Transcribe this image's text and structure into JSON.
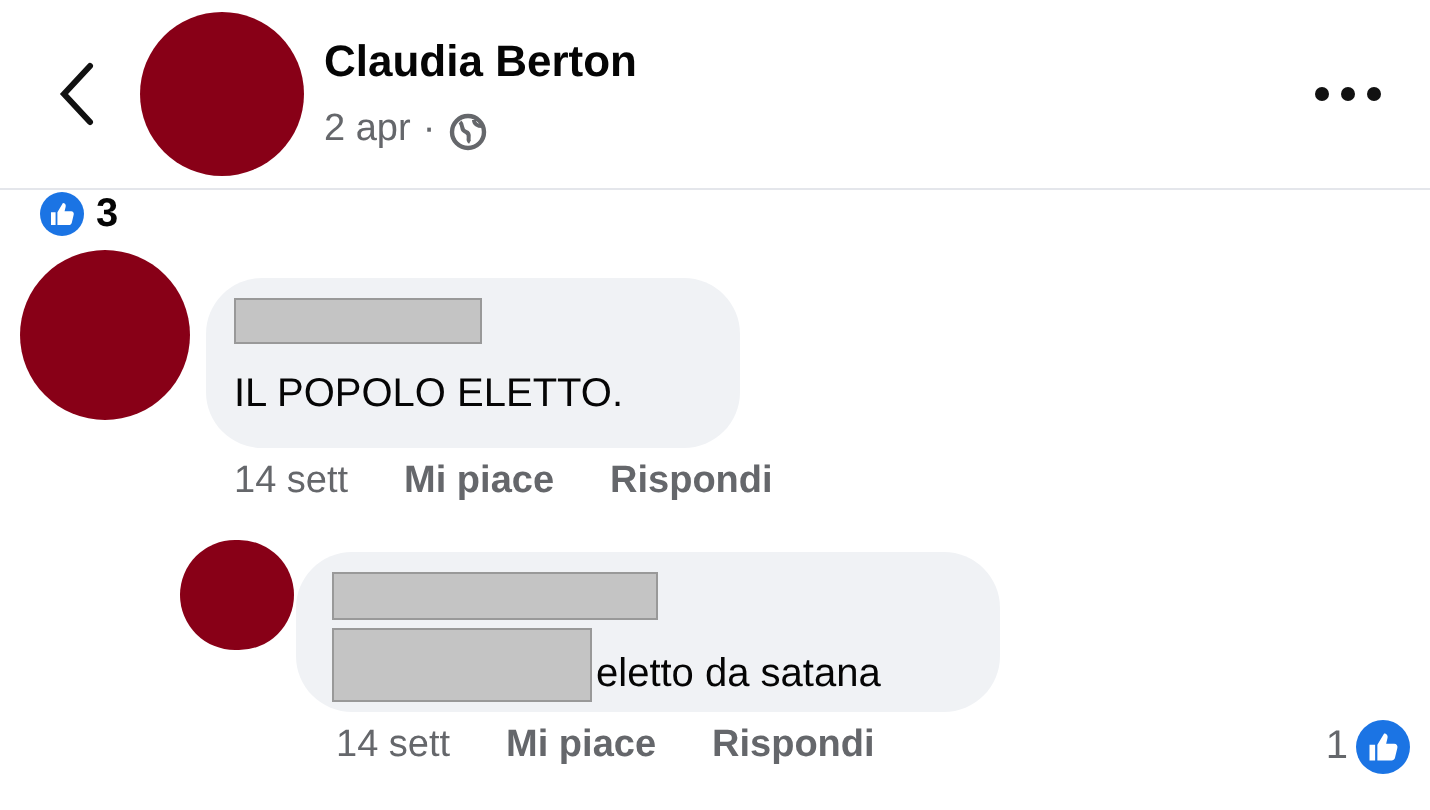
{
  "header": {
    "name": "Claudia Berton",
    "date": "2 apr",
    "separator": "·"
  },
  "post_reactions": {
    "count": "3"
  },
  "comments": [
    {
      "text": "IL POPOLO ELETTO.",
      "time": "14 sett",
      "like": "Mi piace",
      "reply": "Rispondi",
      "replies": [
        {
          "text": "eletto da satana",
          "time": "14 sett",
          "like": "Mi piace",
          "reply": "Rispondi",
          "reaction_count": "1"
        }
      ]
    }
  ]
}
